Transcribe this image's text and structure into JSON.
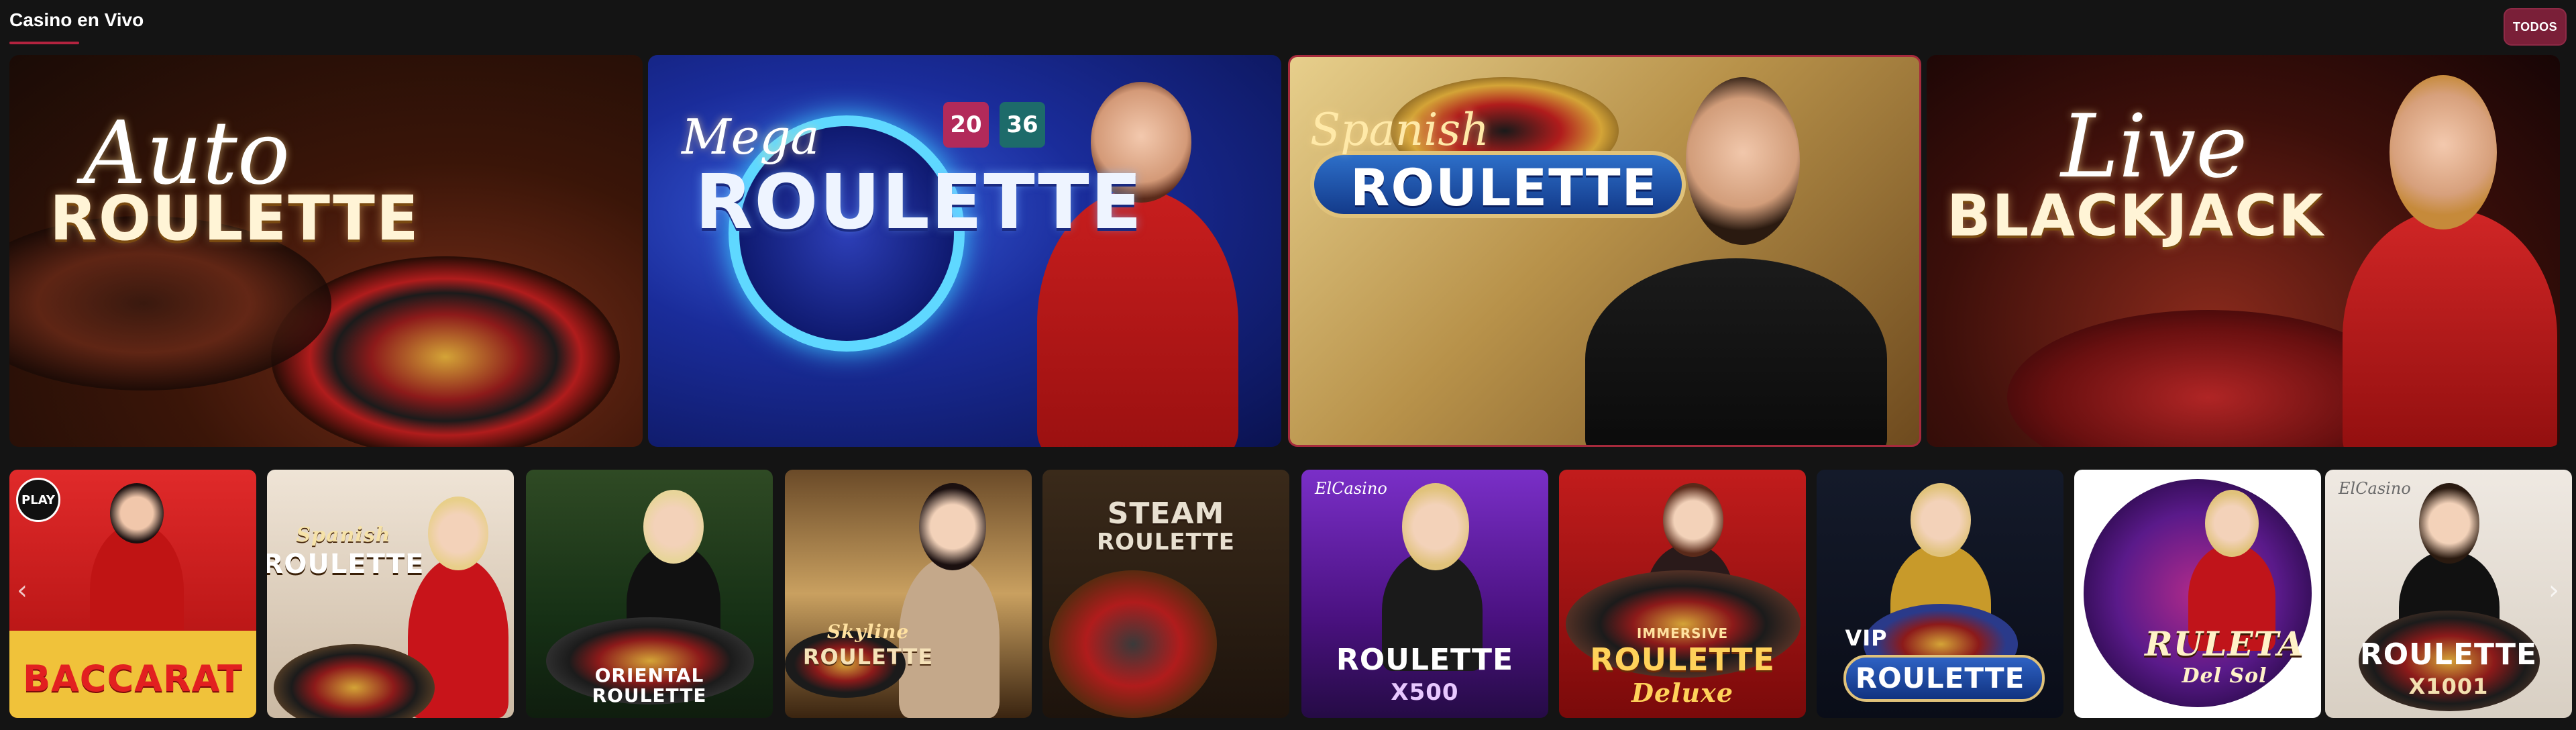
{
  "section": {
    "title": "Casino en Vivo",
    "view_all_label": "TODOS"
  },
  "featured_games": [
    {
      "script": "Auto",
      "name": "ROULETTE"
    },
    {
      "script": "Mega",
      "name": "ROULETTE",
      "badges": [
        "20",
        "36"
      ]
    },
    {
      "script": "Spanish",
      "name": "ROULETTE"
    },
    {
      "script": "Live",
      "name": "BLACKJACK"
    }
  ],
  "games": [
    {
      "title": "BACCARAT",
      "badge": "PLAY"
    },
    {
      "title_top": "Spanish",
      "title": "ROULETTE"
    },
    {
      "title_top": "ORIENTAL",
      "title": "ROULETTE"
    },
    {
      "title_top": "Skyline",
      "title": "ROULETTE"
    },
    {
      "title_top": "STEAM",
      "title": "ROULETTE"
    },
    {
      "brand": "ElCasino",
      "title": "ROULETTE",
      "subtitle": "X500"
    },
    {
      "title_top": "IMMERSIVE",
      "title": "ROULETTE",
      "subtitle": "Deluxe"
    },
    {
      "title_top": "VIP",
      "title": "ROULETTE"
    },
    {
      "title": "RULETA",
      "subtitle": "Del Sol"
    },
    {
      "brand": "ElCasino",
      "title": "ROULETTE",
      "subtitle": "X1001"
    }
  ],
  "colors": {
    "background": "#141414",
    "accent": "#b3233f",
    "view_all_bg": "#7a1f38"
  },
  "icons": {
    "prev": "chevron-left-icon",
    "next": "chevron-right-icon"
  }
}
